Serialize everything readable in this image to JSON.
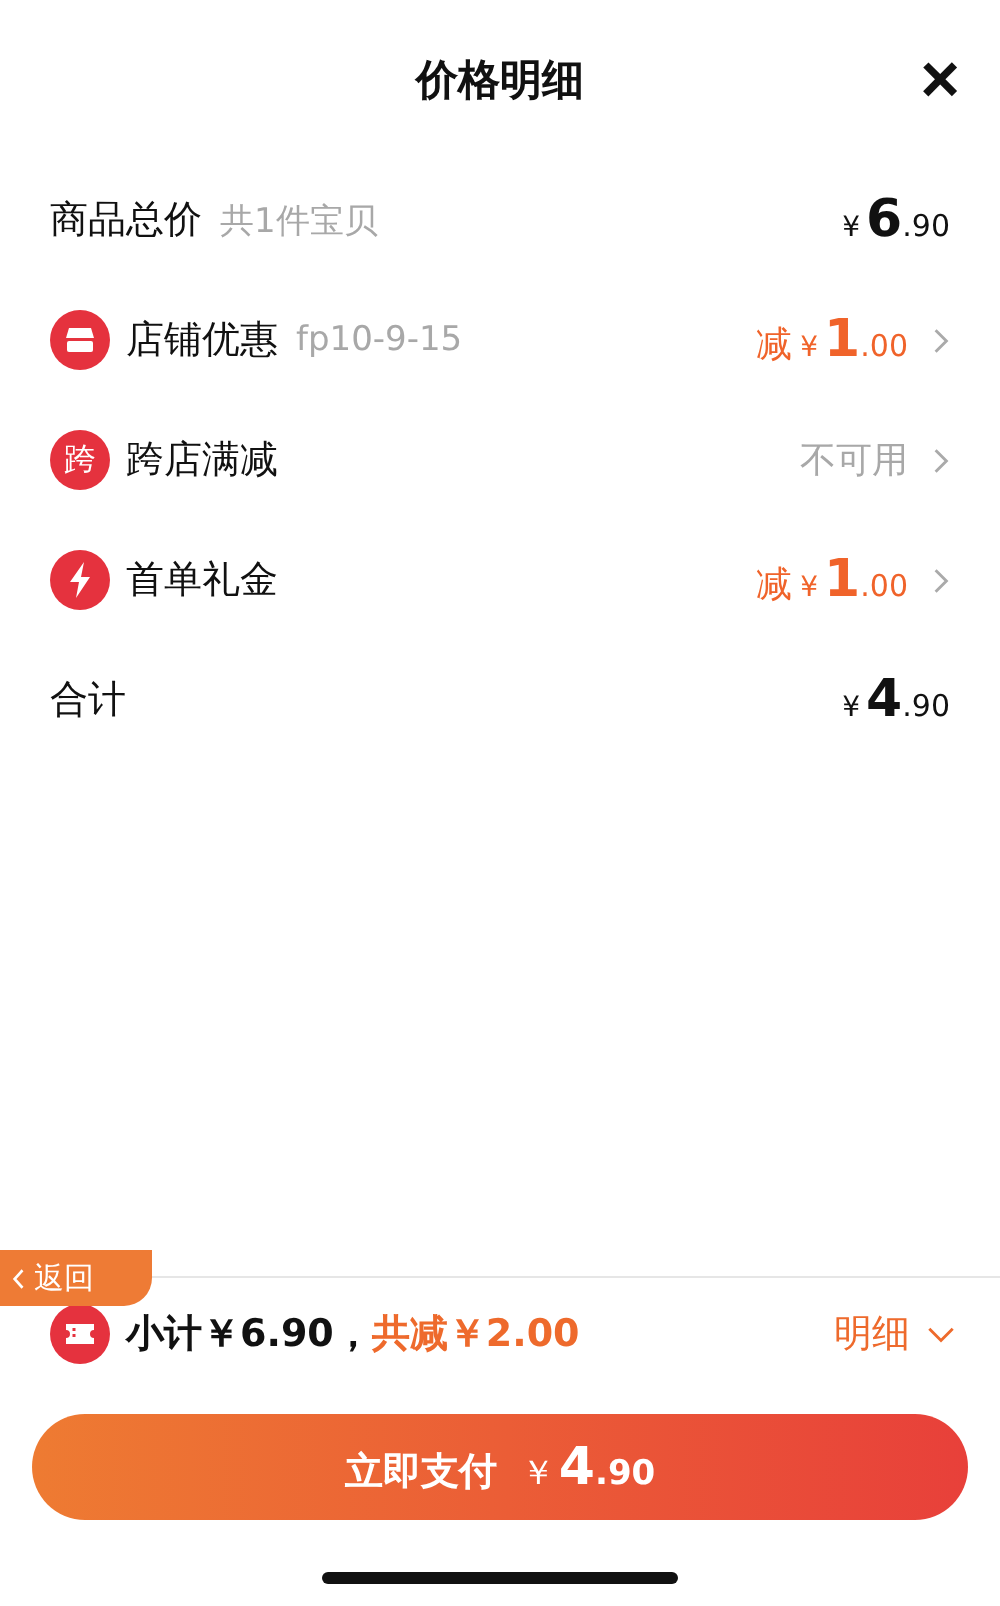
{
  "header": {
    "title": "价格明细",
    "close": "×"
  },
  "rows": [
    {
      "kind": "plain",
      "label": "商品总价",
      "note": "共1件宝贝",
      "price": {
        "yuan": "¥",
        "int": "6",
        "dec": ".90"
      }
    },
    {
      "kind": "shop",
      "label": "店铺优惠",
      "note": "fp10-9-15",
      "price": {
        "prefix": "减",
        "yuan": "¥",
        "int": "1",
        "dec": ".00"
      }
    },
    {
      "kind": "cross_store",
      "icon_text": "跨",
      "label": "跨店满减",
      "status": "不可用"
    },
    {
      "kind": "gift",
      "label": "首单礼金",
      "price": {
        "prefix": "减",
        "yuan": "¥",
        "int": "1",
        "dec": ".00"
      }
    },
    {
      "kind": "plain",
      "label": "合计",
      "price": {
        "yuan": "¥",
        "int": "4",
        "dec": ".90"
      }
    }
  ],
  "back_tab": {
    "label": "返回"
  },
  "summary": {
    "subtotal": "小计￥6.90，",
    "discount": "共减￥2.00",
    "detail": "明细",
    "expanded": false
  },
  "pay_button": {
    "label": "立即支付",
    "yuan": "￥",
    "int": "4",
    "dec": ".90"
  }
}
